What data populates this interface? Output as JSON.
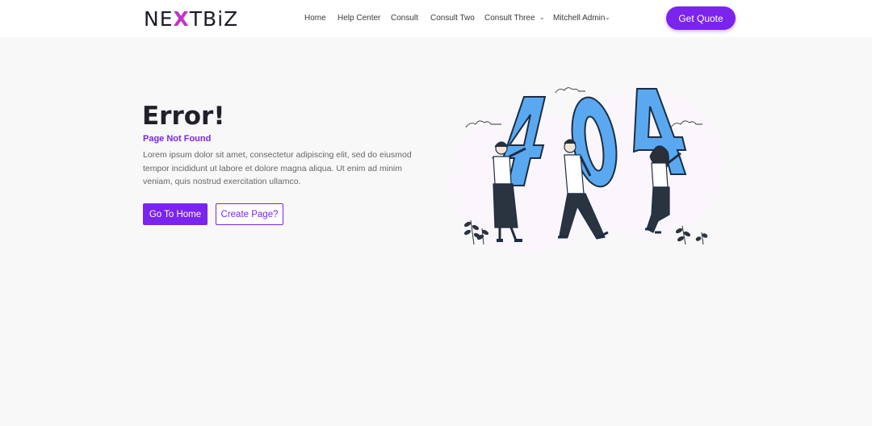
{
  "header": {
    "logo_text": {
      "pre": "NE",
      "mid": "X",
      "post": "TBiZ"
    },
    "nav": [
      "Home",
      "Help Center",
      "Consult",
      "Consult Two",
      "Consult Three"
    ],
    "user_menu": "Mitchell Admin",
    "cta": "Get Quote"
  },
  "main": {
    "title": "Error!",
    "subtitle": "Page Not Found",
    "description": "Lorem ipsum dolor sit amet, consectetur adipiscing elit, sed do eiusmod tempor incididunt ut labore et dolore magna aliqua. Ut enim ad minim veniam, quis nostrud exercitation ullamco.",
    "primary_button": "Go To Home",
    "secondary_button": "Create Page?"
  },
  "illustration": {
    "digits": [
      "4",
      "0",
      "4"
    ],
    "icon": "404-people-illustration"
  },
  "colors": {
    "accent": "#7a24ee",
    "logo_accent": "#c531c9",
    "digit_fill": "#5aa9f0",
    "background": "#f8f8f9"
  }
}
